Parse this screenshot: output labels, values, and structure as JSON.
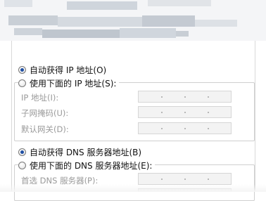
{
  "auto_ip": {
    "label": "自动获得 IP 地址(O)",
    "checked": true
  },
  "manual_ip": {
    "label": "使用下面的 IP 地址(S):",
    "checked": false,
    "fields": [
      {
        "label": "IP 地址(I):",
        "value": ""
      },
      {
        "label": "子网掩码(U):",
        "value": ""
      },
      {
        "label": "默认网关(D):",
        "value": ""
      }
    ]
  },
  "auto_dns": {
    "label": "自动获得 DNS 服务器地址(B)",
    "checked": true
  },
  "manual_dns": {
    "label": "使用下面的 DNS 服务器地址(E):",
    "checked": false,
    "fields": [
      {
        "label": "首选 DNS 服务器(P):",
        "value": ""
      }
    ]
  },
  "colors": {
    "selected_radio": "#1f4fa3",
    "disabled_text": "#9a9a9a",
    "disabled_field_bg": "#f3f3f3"
  }
}
